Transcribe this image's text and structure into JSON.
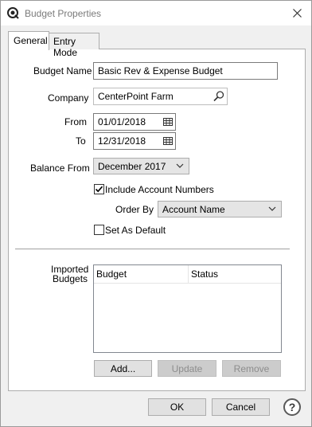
{
  "window": {
    "title": "Budget Properties"
  },
  "tabs": [
    {
      "label": "General",
      "active": true
    },
    {
      "label": "Entry Mode",
      "active": false
    }
  ],
  "form": {
    "budget_name_label": "Budget Name",
    "budget_name_value": "Basic Rev & Expense Budget",
    "company_label": "Company",
    "company_value": "CenterPoint Farm",
    "from_label": "From",
    "from_value": "01/01/2018",
    "to_label": "To",
    "to_value": "12/31/2018",
    "balance_from_label": "Balance From",
    "balance_from_value": "December 2017",
    "include_account_numbers_label": "Include Account Numbers",
    "include_account_numbers_checked": true,
    "order_by_label": "Order By",
    "order_by_value": "Account Name",
    "set_as_default_label": "Set As Default",
    "set_as_default_checked": false
  },
  "imported": {
    "label_line1": "Imported",
    "label_line2": "Budgets",
    "columns": [
      "Budget",
      "Status"
    ],
    "rows": []
  },
  "buttons": {
    "add": "Add...",
    "update": "Update",
    "remove": "Remove",
    "ok": "OK",
    "cancel": "Cancel",
    "help": "?"
  },
  "icons": {
    "app": "app-logo-icon",
    "close": "close-icon",
    "search": "search-icon",
    "calendar": "calendar-icon",
    "dropdown": "chevron-down-icon",
    "check": "checkmark-icon",
    "help": "help-icon"
  },
  "colors": {
    "window_bg": "#f0f0f0",
    "panel_bg": "#ffffff",
    "button_bg": "#e1e1e1",
    "disabled_text": "#8d8d8d"
  }
}
